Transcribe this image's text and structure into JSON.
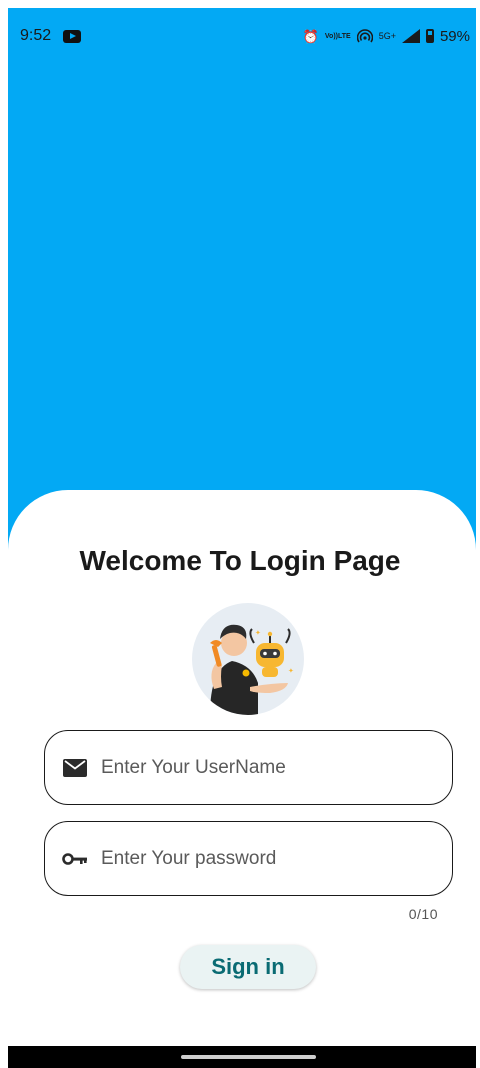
{
  "status_bar": {
    "time": "9:52",
    "icons": [
      "youtube-icon",
      "alarm-icon",
      "volte-icon",
      "hotspot-icon",
      "signal-icon",
      "battery-icon"
    ],
    "volte_top": "Vo))",
    "volte_bottom": "LTE",
    "network": "5G+",
    "battery_text": "59%"
  },
  "colors": {
    "header_blue": "#03A9F4",
    "signin_text": "#0a6b73",
    "signin_bg": "#eaf3f3"
  },
  "login": {
    "title": "Welcome To Login Page",
    "username_placeholder": "Enter Your UserName",
    "password_placeholder": "Enter Your password",
    "password_counter": "0/10",
    "signin_label": "Sign in"
  }
}
